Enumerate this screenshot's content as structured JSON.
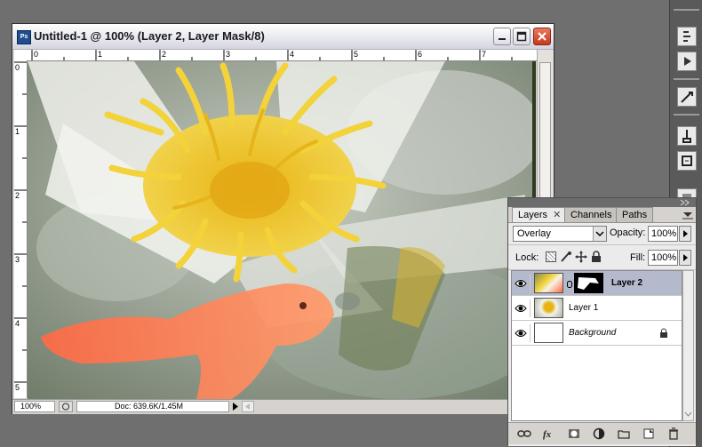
{
  "document_window": {
    "title": "Untitled-1 @ 100% (Layer 2, Layer Mask/8)",
    "app_icon": "Ps",
    "controls": [
      "minimize-icon",
      "maximize-icon",
      "close-icon"
    ]
  },
  "rulers": {
    "horizontal_labels": [
      "0",
      "1",
      "2",
      "3",
      "4",
      "5",
      "6",
      "7"
    ],
    "vertical_labels": [
      "0",
      "1",
      "2",
      "3",
      "4",
      "5"
    ]
  },
  "status_bar": {
    "zoom": "100%",
    "doc_info": "Doc: 639.6K/1.45M"
  },
  "layers_panel": {
    "tabs": [
      {
        "label": "Layers",
        "active": true
      },
      {
        "label": "Channels",
        "active": false
      },
      {
        "label": "Paths",
        "active": false
      }
    ],
    "blend_mode": "Overlay",
    "opacity_label": "Opacity:",
    "opacity_value": "100%",
    "lock_label": "Lock:",
    "fill_label": "Fill:",
    "fill_value": "100%",
    "layers": [
      {
        "name": "Layer 2",
        "visible": true,
        "selected": true,
        "has_mask": true
      },
      {
        "name": "Layer 1",
        "visible": true,
        "selected": false,
        "has_mask": false
      },
      {
        "name": "Background",
        "visible": true,
        "selected": false,
        "locked": true
      }
    ],
    "footer_icons": [
      "link-icon",
      "fx-icon",
      "mask-icon",
      "adjustment-icon",
      "group-icon",
      "new-layer-icon",
      "trash-icon"
    ]
  },
  "dock_icons": [
    "history-icon",
    "actions-icon",
    "tool-presets-icon",
    "brushes-icon",
    "clone-source-icon",
    "styles-icon"
  ]
}
